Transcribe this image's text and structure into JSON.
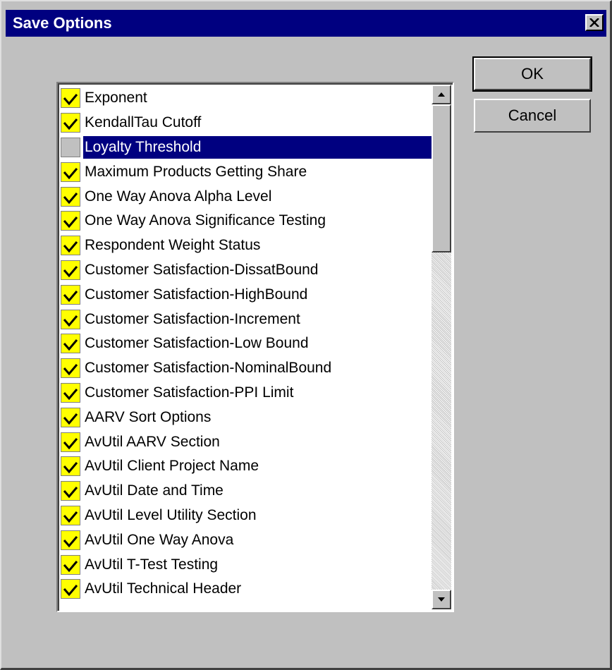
{
  "dialog": {
    "title": "Save Options",
    "ok_label": "OK",
    "cancel_label": "Cancel"
  },
  "list": {
    "items": [
      {
        "label": "Exponent",
        "checked": true
      },
      {
        "label": "KendallTau Cutoff",
        "checked": true
      },
      {
        "label": "Loyalty Threshold",
        "checked": false,
        "selected": true
      },
      {
        "label": "Maximum Products Getting Share",
        "checked": true
      },
      {
        "label": "One Way Anova Alpha Level",
        "checked": true
      },
      {
        "label": "One Way Anova Significance Testing",
        "checked": true
      },
      {
        "label": "Respondent Weight Status",
        "checked": true
      },
      {
        "label": "Customer Satisfaction-DissatBound",
        "checked": true
      },
      {
        "label": "Customer Satisfaction-HighBound",
        "checked": true
      },
      {
        "label": "Customer Satisfaction-Increment",
        "checked": true
      },
      {
        "label": "Customer Satisfaction-Low Bound",
        "checked": true
      },
      {
        "label": "Customer Satisfaction-NominalBound",
        "checked": true
      },
      {
        "label": "Customer Satisfaction-PPI Limit",
        "checked": true
      },
      {
        "label": "AARV Sort Options",
        "checked": true
      },
      {
        "label": "AvUtil AARV Section",
        "checked": true
      },
      {
        "label": "AvUtil Client Project Name",
        "checked": true
      },
      {
        "label": "AvUtil Date and Time",
        "checked": true
      },
      {
        "label": "AvUtil Level Utility Section",
        "checked": true
      },
      {
        "label": "AvUtil One Way Anova",
        "checked": true
      },
      {
        "label": "AvUtil T-Test Testing",
        "checked": true
      },
      {
        "label": "AvUtil Technical Header",
        "checked": true
      }
    ]
  },
  "colors": {
    "titlebar": "#000080",
    "dialog_bg": "#c0c0c0",
    "checkbox_checked": "#ffff00",
    "selection": "#000080"
  },
  "icons": {
    "close": "close-icon",
    "check": "checkmark-icon",
    "scroll_up": "arrow-up-icon",
    "scroll_down": "arrow-down-icon"
  }
}
